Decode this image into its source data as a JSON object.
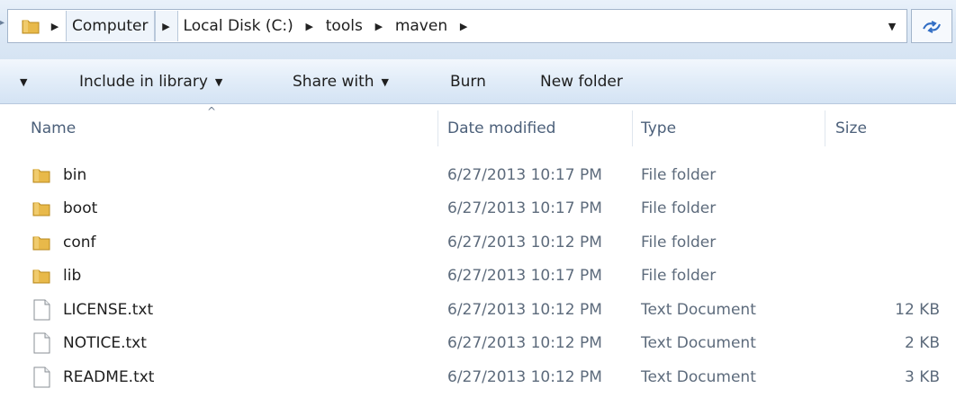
{
  "breadcrumb": {
    "items": [
      "Computer",
      "Local Disk (C:)",
      "tools",
      "maven"
    ]
  },
  "toolbar": {
    "include_in_library": "Include in library",
    "share_with": "Share with",
    "burn": "Burn",
    "new_folder": "New folder"
  },
  "columns": {
    "name": "Name",
    "date_modified": "Date modified",
    "type": "Type",
    "size": "Size"
  },
  "files": [
    {
      "name": "bin",
      "date": "6/27/2013 10:17 PM",
      "type": "File folder",
      "size": "",
      "icon": "folder-icon"
    },
    {
      "name": "boot",
      "date": "6/27/2013 10:17 PM",
      "type": "File folder",
      "size": "",
      "icon": "folder-icon"
    },
    {
      "name": "conf",
      "date": "6/27/2013 10:12 PM",
      "type": "File folder",
      "size": "",
      "icon": "folder-icon"
    },
    {
      "name": "lib",
      "date": "6/27/2013 10:17 PM",
      "type": "File folder",
      "size": "",
      "icon": "folder-icon"
    },
    {
      "name": "LICENSE.txt",
      "date": "6/27/2013 10:12 PM",
      "type": "Text Document",
      "size": "12 KB",
      "icon": "text-document-icon"
    },
    {
      "name": "NOTICE.txt",
      "date": "6/27/2013 10:12 PM",
      "type": "Text Document",
      "size": "2 KB",
      "icon": "text-document-icon"
    },
    {
      "name": "README.txt",
      "date": "6/27/2013 10:12 PM",
      "type": "Text Document",
      "size": "3 KB",
      "icon": "text-document-icon"
    }
  ],
  "colors": {
    "folder": "#e8b94a",
    "toolbar_gradient_top": "#f2f7fd",
    "toolbar_gradient_bottom": "#d4e3f4",
    "header_text": "#4c607a",
    "detail_text": "#5d6b7c"
  }
}
